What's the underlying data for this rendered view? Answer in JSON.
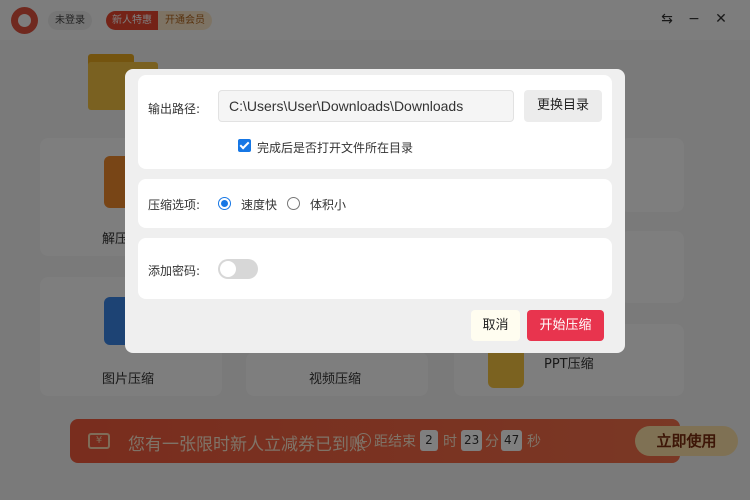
{
  "titlebar": {
    "login_label": "未登录",
    "promo_new": "新人特惠",
    "promo_vip": "开通会员",
    "controls": [
      "swap-icon",
      "minimize-icon",
      "close-icon"
    ]
  },
  "features": {
    "decompress_label": "解压",
    "image_label": "图片压缩",
    "video_label": "视频压缩",
    "ppt_label": "PPT压缩"
  },
  "banner": {
    "message": "您有一张限时新人立减券已到账",
    "countdown_prefix": "距结束",
    "hours": "2",
    "hours_unit": "时",
    "minutes": "23",
    "minutes_unit": "分",
    "seconds": "47",
    "seconds_unit": "秒",
    "use_button": "立即使用"
  },
  "dialog": {
    "output_path_label": "输出路径:",
    "output_path_value": "C:\\Users\\User\\Downloads\\Downloads",
    "change_dir_button": "更换目录",
    "open_after_label": "完成后是否打开文件所在目录",
    "open_after_checked": true,
    "compress_option_label": "压缩选项:",
    "option_fast": "速度快",
    "option_small": "体积小",
    "selected_option": "速度快",
    "password_label": "添加密码:",
    "password_enabled": false,
    "cancel_button": "取消",
    "start_button": "开始压缩"
  },
  "colors": {
    "primary_red": "#e8344e",
    "accent_blue": "#1677e5",
    "banner_orange": "#f25a3c"
  }
}
